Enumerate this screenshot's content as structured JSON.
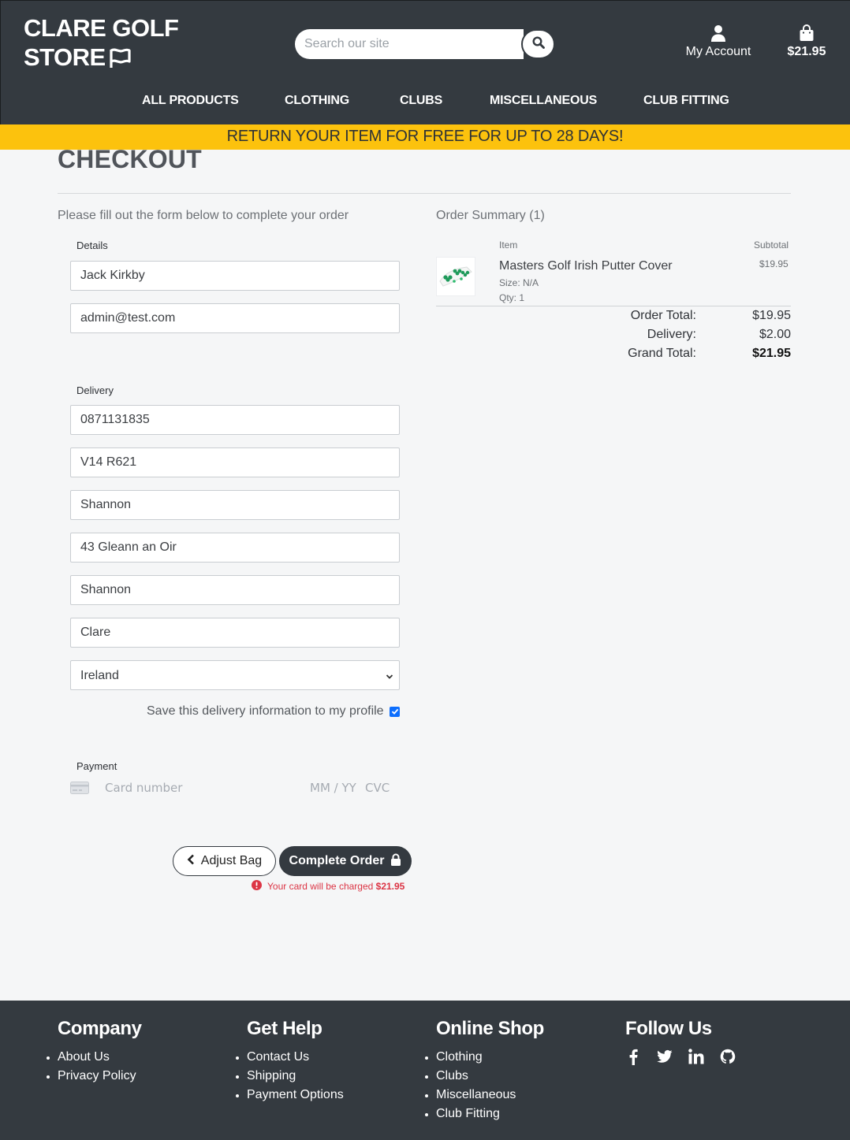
{
  "header": {
    "logo_line1": "CLARE GOLF",
    "logo_line2": "STORE",
    "search_placeholder": "Search our site",
    "account_label": "My Account",
    "bag_total": "$21.95"
  },
  "nav": {
    "items": [
      "ALL PRODUCTS",
      "CLOTHING",
      "CLUBS",
      "MISCELLANEOUS",
      "CLUB FITTING"
    ]
  },
  "banner": "RETURN YOUR ITEM FOR FREE FOR UP TO 28 DAYS!",
  "checkout": {
    "title": "CHECKOUT",
    "intro": "Please fill out the form below to complete your order",
    "details_label": "Details",
    "full_name": "Jack Kirkby",
    "email": "admin@test.com",
    "delivery_label": "Delivery",
    "phone": "0871131835",
    "postcode": "V14 R621",
    "town": "Shannon",
    "street1": "43 Gleann an Oir",
    "street2": "Shannon",
    "county": "Clare",
    "country": "Ireland",
    "save_info_label": "Save this delivery information to my profile",
    "save_info_checked": true,
    "payment_label": "Payment",
    "card_placeholder": "Card number",
    "expiry_placeholder": "MM / YY",
    "cvc_placeholder": "CVC",
    "adjust_bag_label": "Adjust Bag",
    "complete_order_label": "Complete Order",
    "charge_text": "Your card will be charged",
    "charge_amount": "$21.95"
  },
  "summary": {
    "title": "Order Summary (1)",
    "col_item": "Item",
    "col_subtotal": "Subtotal",
    "item": {
      "name": "Masters Golf Irish Putter Cover",
      "size": "Size: N/A",
      "qty": "Qty: 1",
      "subtotal": "$19.95"
    },
    "order_total_label": "Order Total:",
    "order_total": "$19.95",
    "delivery_label": "Delivery:",
    "delivery": "$2.00",
    "grand_total_label": "Grand Total:",
    "grand_total": "$21.95"
  },
  "footer": {
    "company": {
      "title": "Company",
      "links": [
        "About Us",
        "Privacy Policy"
      ]
    },
    "help": {
      "title": "Get Help",
      "links": [
        "Contact Us",
        "Shipping",
        "Payment Options"
      ]
    },
    "shop": {
      "title": "Online Shop",
      "links": [
        "Clothing",
        "Clubs",
        "Miscellaneous",
        "Club Fitting"
      ]
    },
    "follow": {
      "title": "Follow Us",
      "icons": [
        "facebook-icon",
        "twitter-icon",
        "linkedin-icon",
        "github-icon"
      ]
    }
  },
  "colors": {
    "dark": "#343a40",
    "banner": "#fcc20d",
    "error": "#dc3545",
    "checkbox": "#0d6efd"
  }
}
